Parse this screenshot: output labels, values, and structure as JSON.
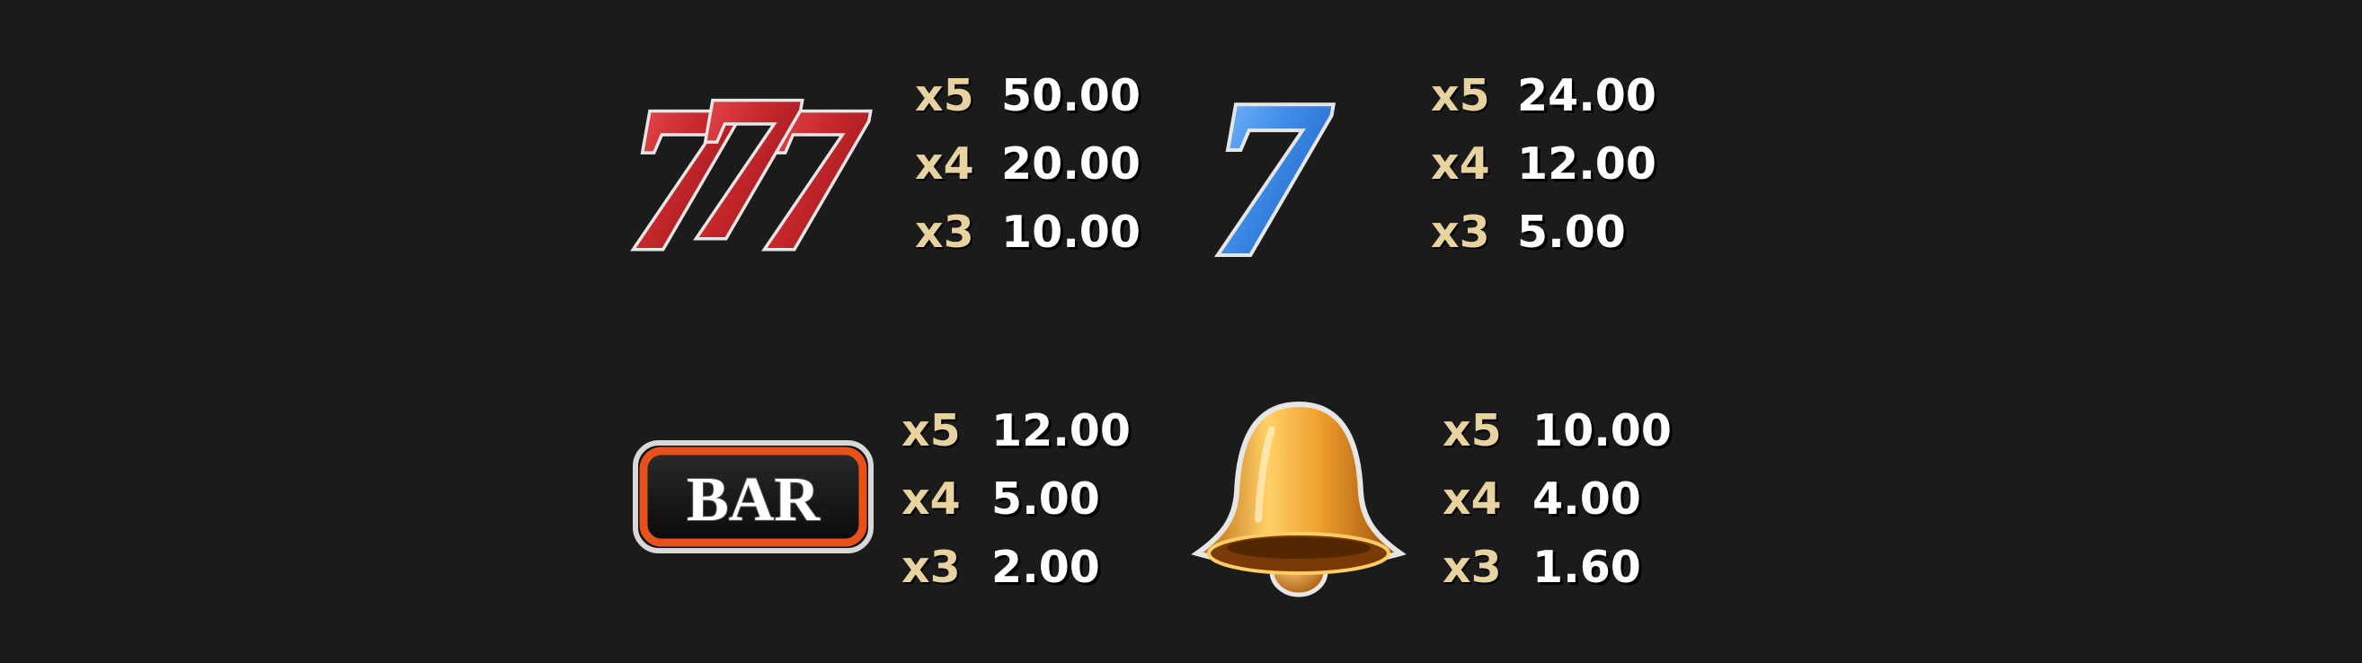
{
  "colors": {
    "background": "#1b1b1b",
    "multiplier_text": "#e8d3a0",
    "amount_text": "#ffffff",
    "seven_red": "#c8282c",
    "seven_blue": "#3d8be8",
    "bell_gold": "#f0a02c",
    "bar_border": "#e8501c"
  },
  "symbols": [
    {
      "icon": "triple-red-seven-icon",
      "glyph": "7",
      "pays": [
        {
          "mult": "x5",
          "amount": "50.00"
        },
        {
          "mult": "x4",
          "amount": "20.00"
        },
        {
          "mult": "x3",
          "amount": "10.00"
        }
      ]
    },
    {
      "icon": "blue-seven-icon",
      "glyph": "7",
      "pays": [
        {
          "mult": "x5",
          "amount": "24.00"
        },
        {
          "mult": "x4",
          "amount": "12.00"
        },
        {
          "mult": "x3",
          "amount": "5.00"
        }
      ]
    },
    {
      "icon": "bar-icon",
      "glyph": "BAR",
      "pays": [
        {
          "mult": "x5",
          "amount": "12.00"
        },
        {
          "mult": "x4",
          "amount": "5.00"
        },
        {
          "mult": "x3",
          "amount": "2.00"
        }
      ]
    },
    {
      "icon": "bell-icon",
      "pays": [
        {
          "mult": "x5",
          "amount": "10.00"
        },
        {
          "mult": "x4",
          "amount": "4.00"
        },
        {
          "mult": "x3",
          "amount": "1.60"
        }
      ]
    }
  ]
}
